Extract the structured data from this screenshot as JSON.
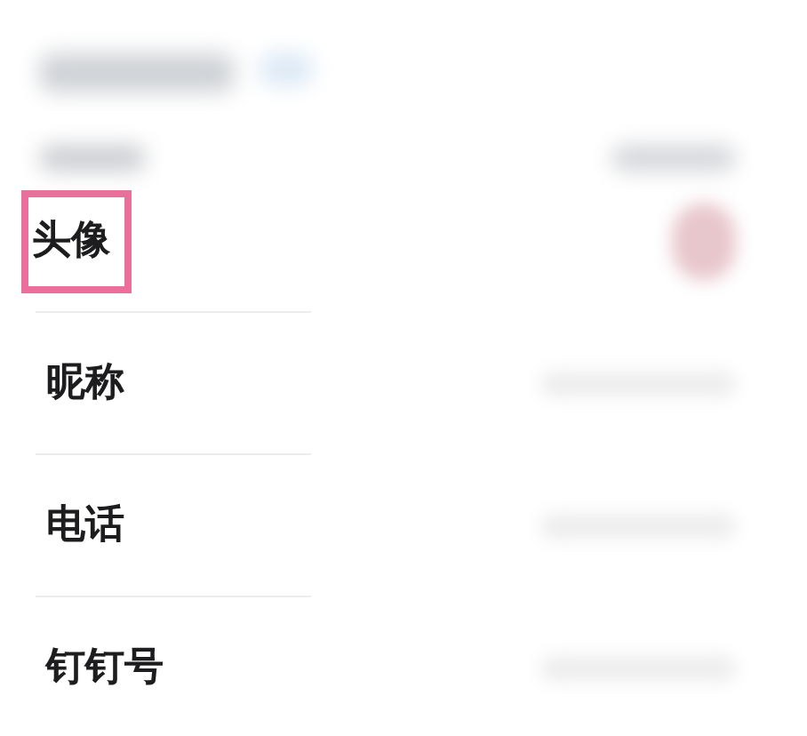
{
  "rows": [
    {
      "label": "头像",
      "highlighted": true,
      "kind": "avatar"
    },
    {
      "label": "昵称",
      "highlighted": false,
      "kind": "value"
    },
    {
      "label": "电话",
      "highlighted": false,
      "kind": "value"
    },
    {
      "label": "钉钉号",
      "highlighted": false,
      "kind": "value"
    }
  ]
}
